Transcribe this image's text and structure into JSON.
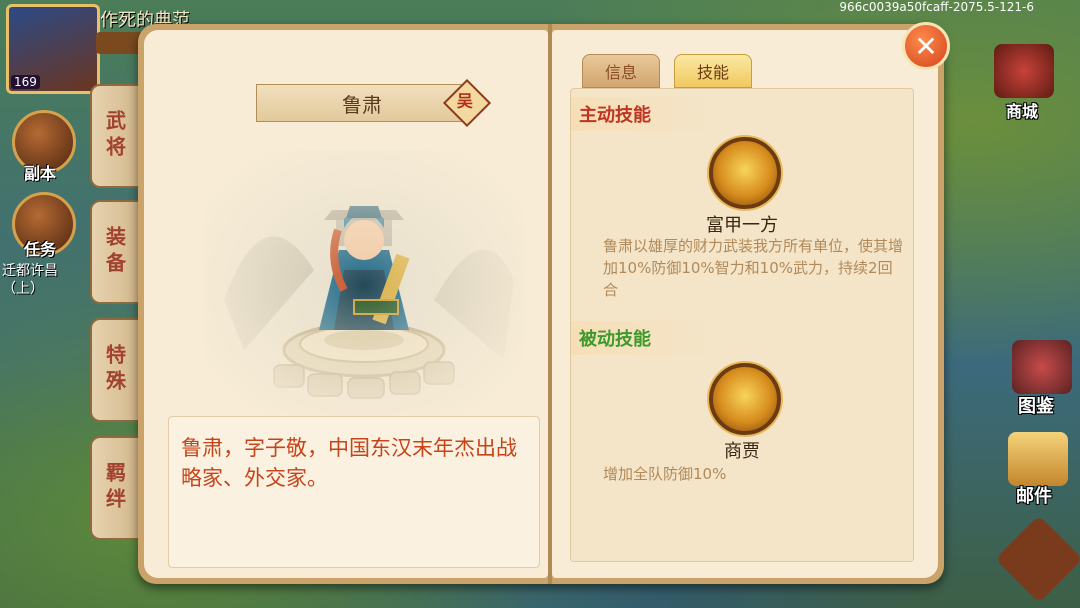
{
  "watermark": "966c0039a50fcaff-2075.5-121-6",
  "hud": {
    "top_name": "作死的典范",
    "avatar_level": "169",
    "left_buttons": [
      {
        "label": "副本",
        "icon": "crossed-swords-icon"
      },
      {
        "label": "任务",
        "icon": "scroll-icon"
      }
    ],
    "task_subtitle": "迁都许昌（上）",
    "side_tabs": [
      "武将",
      "装备",
      "特殊",
      "羁绊"
    ],
    "right_buttons": [
      {
        "label": "商城",
        "icon": "shop-icon"
      },
      {
        "label": "图鉴",
        "icon": "codex-icon"
      },
      {
        "label": "邮件",
        "icon": "mail-icon"
      }
    ]
  },
  "hero": {
    "name": "鲁肃",
    "kingdom_badge": "吴",
    "description": "鲁肃，字子敬，中国东汉末年杰出战略家、外交家。"
  },
  "tabs": [
    {
      "label": "信息",
      "selected": false
    },
    {
      "label": "技能",
      "selected": true
    }
  ],
  "skills": {
    "active_title": "主动技能",
    "active": {
      "name": "富甲一方",
      "icon": "gold-treasure-icon",
      "desc": "鲁肃以雄厚的财力武装我方所有单位，使其增加10%防御10%智力和10%武力，持续2回合"
    },
    "passive_title": "被动技能",
    "passive": {
      "name": "商贾",
      "icon": "gold-ingot-icon",
      "desc": "增加全队防御10%"
    }
  },
  "close_icon": "close-icon",
  "colors": {
    "active_title": "#c13320",
    "passive_title": "#3d9a2a",
    "description_text": "#c6441a",
    "parchment": "#f8ecd6"
  }
}
